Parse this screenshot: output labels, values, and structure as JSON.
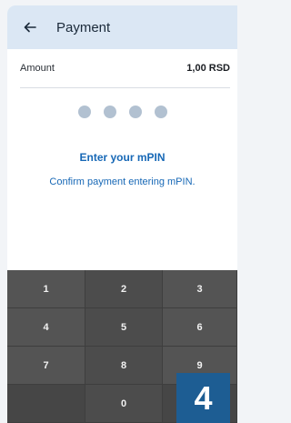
{
  "header": {
    "title": "Payment",
    "back_icon": "arrow-left-icon"
  },
  "amount": {
    "label": "Amount",
    "value": "1,00 RSD"
  },
  "pin": {
    "length": 4,
    "filled": 0
  },
  "prompt": {
    "title": "Enter your mPIN",
    "subtitle": "Confirm payment entering mPIN."
  },
  "keypad": {
    "keys": [
      "1",
      "2",
      "3",
      "4",
      "5",
      "6",
      "7",
      "8",
      "9",
      "",
      "0",
      ""
    ]
  },
  "badge": {
    "text": "4"
  },
  "colors": {
    "accent": "#1768b6",
    "header_bg": "#dbe7f4",
    "keypad_bg": "#4b4b4b",
    "badge_bg": "#1d5d93"
  }
}
